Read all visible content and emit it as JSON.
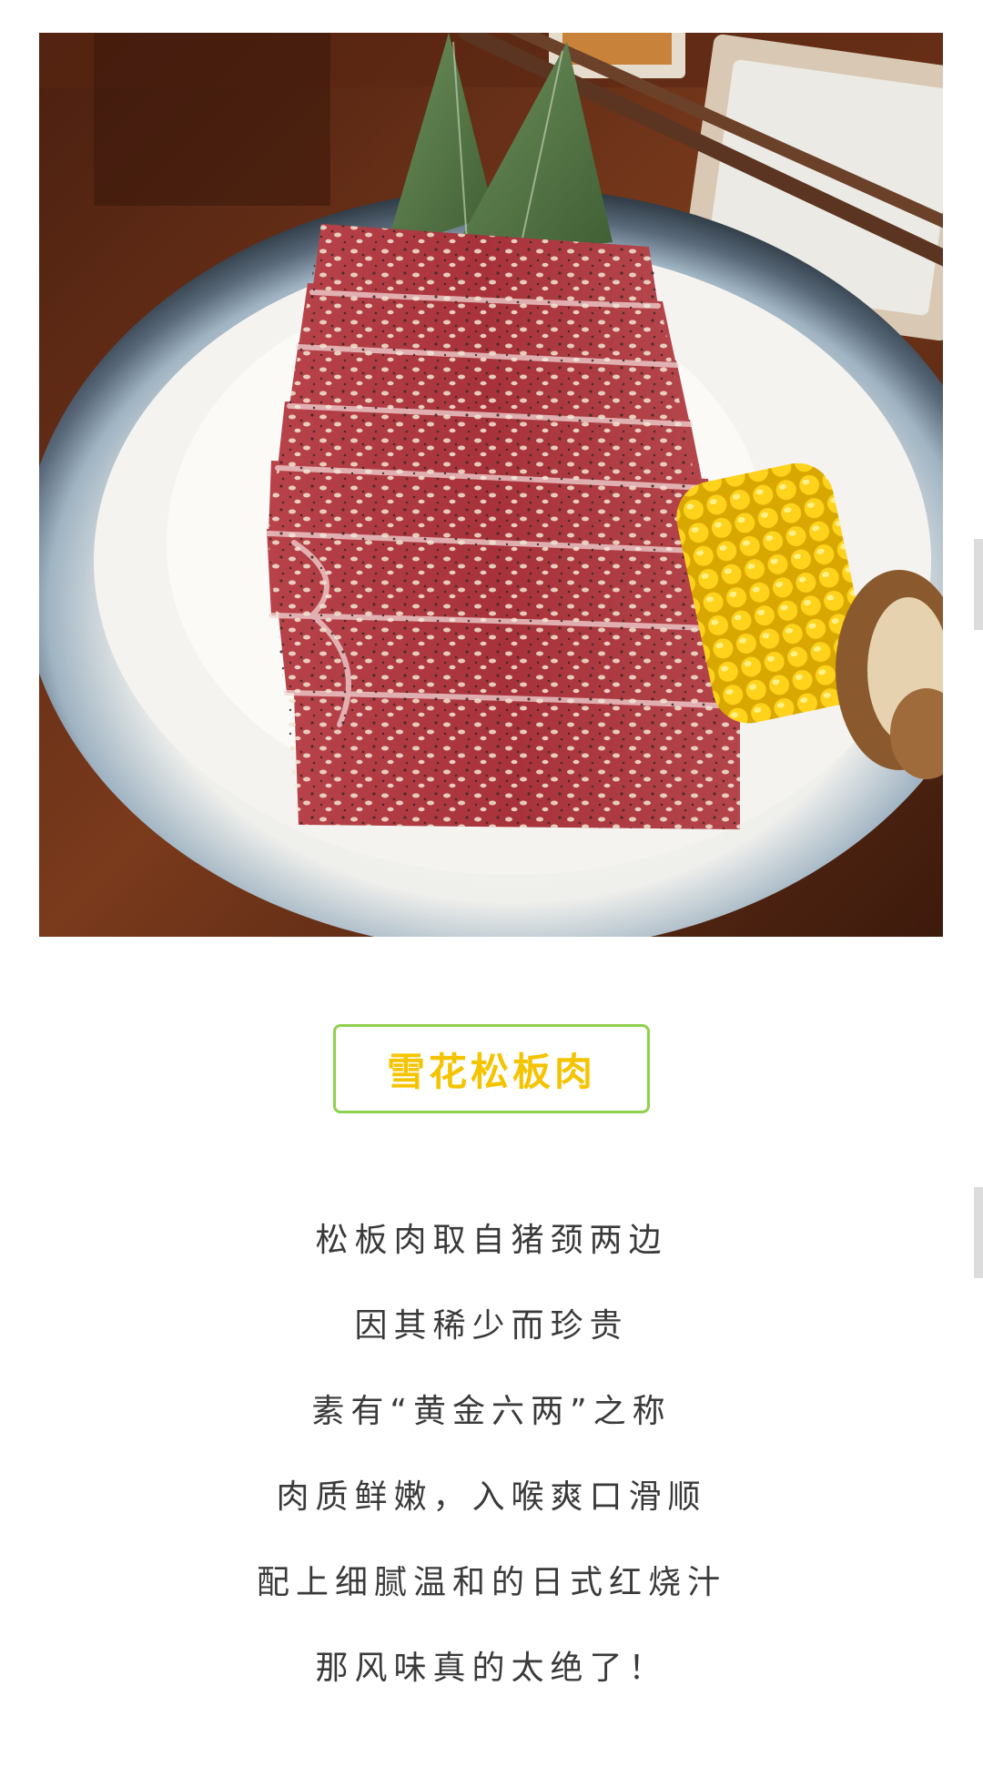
{
  "title": "雪花松板肉",
  "description_lines": [
    "松板肉取自猪颈两边",
    "因其稀少而珍贵",
    "素有“黄金六两”之称",
    "肉质鲜嫩，入喉爽口滑顺",
    "配上细腻温和的日式红烧汁",
    "那风味真的太绝了！"
  ],
  "colors": {
    "title_text": "#f5c400",
    "title_border": "#8fd14f",
    "body_text": "#3a3a3a"
  }
}
